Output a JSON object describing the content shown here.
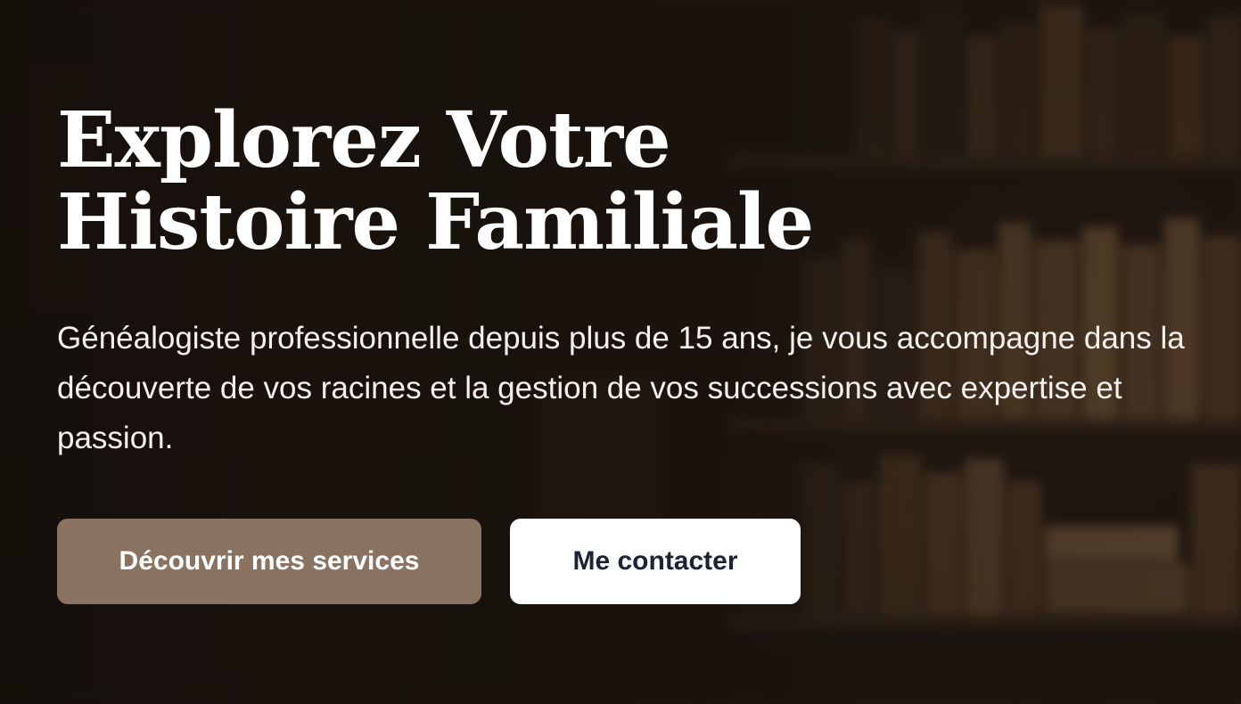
{
  "hero": {
    "title": "Explorez Votre Histoire Familiale",
    "description": "Généalogiste professionnelle depuis plus de 15 ans, je vous accompagne dans la découverte de vos racines et la gestion de vos successions avec expertise et passion.",
    "primary_button_label": "Découvrir mes services",
    "secondary_button_label": "Me contacter"
  },
  "colors": {
    "primary_button": "#8a7261",
    "secondary_button": "#ffffff",
    "secondary_button_text": "#1c2333",
    "background": "#1e1712"
  }
}
